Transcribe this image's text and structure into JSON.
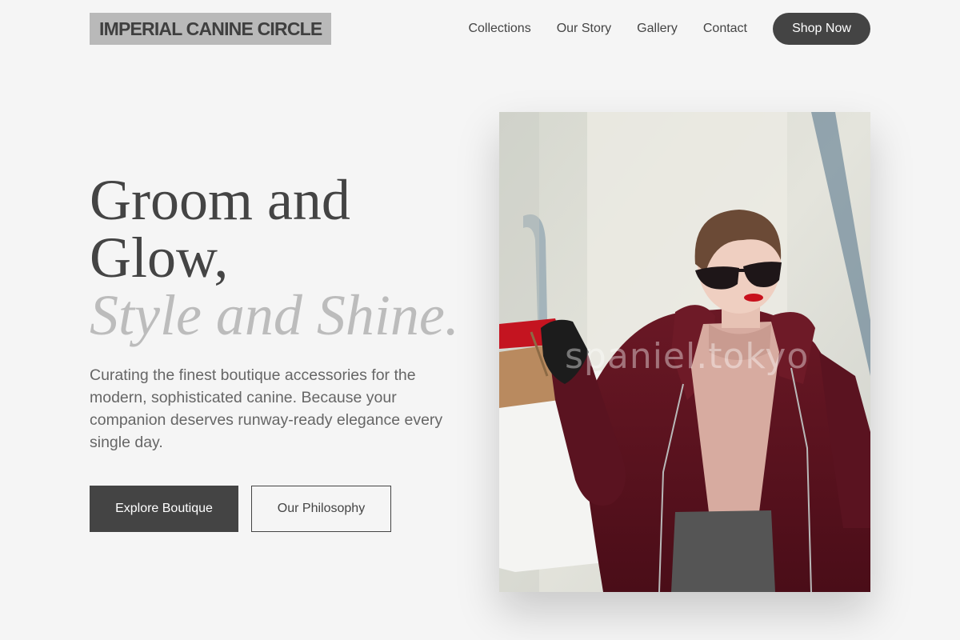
{
  "brand": {
    "logo_text": "IMPERIAL CANINE CIRCLE"
  },
  "nav": {
    "items": [
      "Collections",
      "Our Story",
      "Gallery",
      "Contact"
    ],
    "cta_label": "Shop Now"
  },
  "hero": {
    "title_line1": "Groom and",
    "title_line2": "Glow,",
    "title_line3": "Style and Shine.",
    "description": "Curating the finest boutique accessories for the modern, sophisticated canine. Because your companion deserves runway-ready elegance every single day.",
    "primary_button": "Explore Boutique",
    "secondary_button": "Our Philosophy",
    "image_watermark": "spaniel.tokyo"
  },
  "colors": {
    "background": "#f5f5f5",
    "primary": "#444444",
    "logo_bg": "#b9b9b9",
    "italic_accent": "#bcbcbc",
    "coat": "#5e1420"
  }
}
